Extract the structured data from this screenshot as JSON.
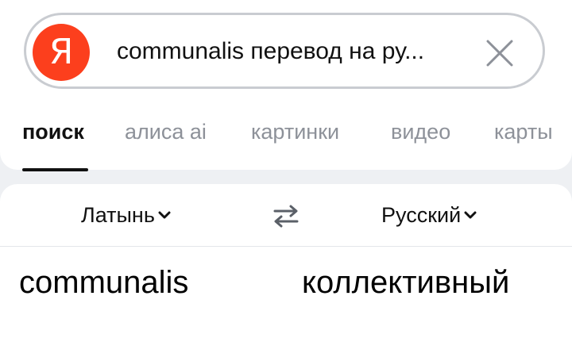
{
  "search": {
    "logo_letter": "Я",
    "query": "communalis перевод на ру...",
    "clear_icon": "close-icon",
    "logo_color": "#fc3f1d"
  },
  "tabs": [
    {
      "label": "поиск",
      "active": true
    },
    {
      "label": "алиса ai",
      "active": false
    },
    {
      "label": "картинки",
      "active": false
    },
    {
      "label": "видео",
      "active": false
    },
    {
      "label": "карты",
      "active": false
    }
  ],
  "translator": {
    "source_lang": "Латынь",
    "target_lang": "Русский",
    "swap_icon": "swap-arrows-icon",
    "source_word": "communalis",
    "target_word": "коллективный"
  }
}
